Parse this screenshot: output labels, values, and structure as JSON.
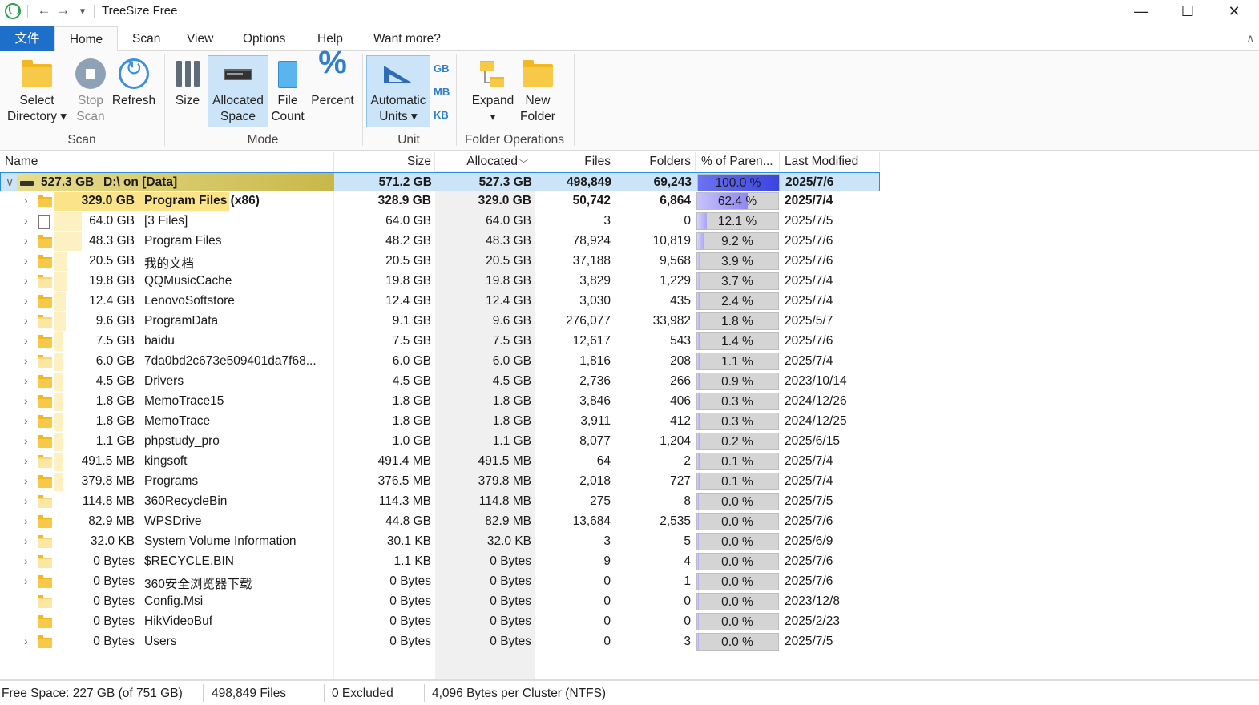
{
  "window": {
    "title": "TreeSize Free",
    "back_glyph": "←",
    "forward_glyph": "→",
    "dropdown_glyph": "▾",
    "minimize_glyph": "—",
    "maximize_glyph": "☐",
    "close_glyph": "✕"
  },
  "ribbon_tabs": {
    "file": "文件",
    "home": "Home",
    "scan": "Scan",
    "view": "View",
    "options": "Options",
    "help": "Help",
    "want_more": "Want more?",
    "collapse_glyph": "∧"
  },
  "ribbon": {
    "select_directory": {
      "line1": "Select",
      "line2": "Directory ▾"
    },
    "stop_scan": {
      "line1": "Stop",
      "line2": "Scan"
    },
    "refresh": {
      "line1": "Refresh"
    },
    "size": {
      "line1": "Size"
    },
    "allocated_space": {
      "line1": "Allocated",
      "line2": "Space"
    },
    "file_count": {
      "line1": "File",
      "line2": "Count"
    },
    "percent": {
      "line1": "Percent",
      "glyph": "%"
    },
    "automatic_units": {
      "line1": "Automatic",
      "line2": "Units ▾"
    },
    "unit_gb": "GB",
    "unit_mb": "MB",
    "unit_kb": "KB",
    "expand": {
      "line1": "Expand",
      "line2": "▾"
    },
    "new_folder": {
      "line1": "New",
      "line2": "Folder"
    },
    "groups": {
      "scan": "Scan",
      "mode": "Mode",
      "unit": "Unit",
      "folder_ops": "Folder Operations"
    }
  },
  "columns": {
    "name": "Name",
    "size": "Size",
    "allocated": "Allocated",
    "sort_glyph": "﹀",
    "files": "Files",
    "folders": "Folders",
    "percent_parent": "% of Paren...",
    "last_modified": "Last Modified"
  },
  "rows": [
    {
      "bar_size": "527.3 GB",
      "name": "D:\\  on  [Data]",
      "size": "571.2 GB",
      "allocated": "527.3 GB",
      "files": "498,849",
      "folders": "69,243",
      "pct": "100.0 %",
      "pct_value": 100.0,
      "modified": "2025/7/6",
      "chevron": "∨",
      "kind": "drive"
    },
    {
      "bar_size": "329.0 GB",
      "name": "Program Files (x86)",
      "size": "328.9 GB",
      "allocated": "329.0 GB",
      "files": "50,742",
      "folders": "6,864",
      "pct": "62.4 %",
      "pct_value": 62.4,
      "modified": "2025/7/4",
      "chevron": "›",
      "kind": "folder"
    },
    {
      "bar_size": "64.0 GB",
      "name": "[3 Files]",
      "size": "64.0 GB",
      "allocated": "64.0 GB",
      "files": "3",
      "folders": "0",
      "pct": "12.1 %",
      "pct_value": 12.1,
      "modified": "2025/7/5",
      "chevron": "›",
      "kind": "file"
    },
    {
      "bar_size": "48.3 GB",
      "name": "Program Files",
      "size": "48.2 GB",
      "allocated": "48.3 GB",
      "files": "78,924",
      "folders": "10,819",
      "pct": "9.2 %",
      "pct_value": 9.2,
      "modified": "2025/7/6",
      "chevron": "›",
      "kind": "folder"
    },
    {
      "bar_size": "20.5 GB",
      "name": "我的文档",
      "size": "20.5 GB",
      "allocated": "20.5 GB",
      "files": "37,188",
      "folders": "9,568",
      "pct": "3.9 %",
      "pct_value": 3.9,
      "modified": "2025/7/6",
      "chevron": "›",
      "kind": "folder"
    },
    {
      "bar_size": "19.8 GB",
      "name": "QQMusicCache",
      "size": "19.8 GB",
      "allocated": "19.8 GB",
      "files": "3,829",
      "folders": "1,229",
      "pct": "3.7 %",
      "pct_value": 3.7,
      "modified": "2025/7/4",
      "chevron": "›",
      "kind": "folder-light"
    },
    {
      "bar_size": "12.4 GB",
      "name": "LenovoSoftstore",
      "size": "12.4 GB",
      "allocated": "12.4 GB",
      "files": "3,030",
      "folders": "435",
      "pct": "2.4 %",
      "pct_value": 2.4,
      "modified": "2025/7/4",
      "chevron": "›",
      "kind": "folder"
    },
    {
      "bar_size": "9.6 GB",
      "name": "ProgramData",
      "size": "9.1 GB",
      "allocated": "9.6 GB",
      "files": "276,077",
      "folders": "33,982",
      "pct": "1.8 %",
      "pct_value": 1.8,
      "modified": "2025/5/7",
      "chevron": "›",
      "kind": "folder-light"
    },
    {
      "bar_size": "7.5 GB",
      "name": "baidu",
      "size": "7.5 GB",
      "allocated": "7.5 GB",
      "files": "12,617",
      "folders": "543",
      "pct": "1.4 %",
      "pct_value": 1.4,
      "modified": "2025/7/6",
      "chevron": "›",
      "kind": "folder"
    },
    {
      "bar_size": "6.0 GB",
      "name": "7da0bd2c673e509401da7f68...",
      "size": "6.0 GB",
      "allocated": "6.0 GB",
      "files": "1,816",
      "folders": "208",
      "pct": "1.1 %",
      "pct_value": 1.1,
      "modified": "2025/7/4",
      "chevron": "›",
      "kind": "folder-light"
    },
    {
      "bar_size": "4.5 GB",
      "name": "Drivers",
      "size": "4.5 GB",
      "allocated": "4.5 GB",
      "files": "2,736",
      "folders": "266",
      "pct": "0.9 %",
      "pct_value": 0.9,
      "modified": "2023/10/14",
      "chevron": "›",
      "kind": "folder"
    },
    {
      "bar_size": "1.8 GB",
      "name": "MemoTrace15",
      "size": "1.8 GB",
      "allocated": "1.8 GB",
      "files": "3,846",
      "folders": "406",
      "pct": "0.3 %",
      "pct_value": 0.3,
      "modified": "2024/12/26",
      "chevron": "›",
      "kind": "folder"
    },
    {
      "bar_size": "1.8 GB",
      "name": "MemoTrace",
      "size": "1.8 GB",
      "allocated": "1.8 GB",
      "files": "3,911",
      "folders": "412",
      "pct": "0.3 %",
      "pct_value": 0.3,
      "modified": "2024/12/25",
      "chevron": "›",
      "kind": "folder"
    },
    {
      "bar_size": "1.1 GB",
      "name": "phpstudy_pro",
      "size": "1.0 GB",
      "allocated": "1.1 GB",
      "files": "8,077",
      "folders": "1,204",
      "pct": "0.2 %",
      "pct_value": 0.2,
      "modified": "2025/6/15",
      "chevron": "›",
      "kind": "folder"
    },
    {
      "bar_size": "491.5 MB",
      "name": "kingsoft",
      "size": "491.4 MB",
      "allocated": "491.5 MB",
      "files": "64",
      "folders": "2",
      "pct": "0.1 %",
      "pct_value": 0.1,
      "modified": "2025/7/4",
      "chevron": "›",
      "kind": "folder-light"
    },
    {
      "bar_size": "379.8 MB",
      "name": "Programs",
      "size": "376.5 MB",
      "allocated": "379.8 MB",
      "files": "2,018",
      "folders": "727",
      "pct": "0.1 %",
      "pct_value": 0.1,
      "modified": "2025/7/4",
      "chevron": "›",
      "kind": "folder"
    },
    {
      "bar_size": "114.8 MB",
      "name": "360RecycleBin",
      "size": "114.3 MB",
      "allocated": "114.8 MB",
      "files": "275",
      "folders": "8",
      "pct": "0.0 %",
      "pct_value": 0.0,
      "modified": "2025/7/5",
      "chevron": "›",
      "kind": "folder-light"
    },
    {
      "bar_size": "82.9 MB",
      "name": "WPSDrive",
      "size": "44.8 GB",
      "allocated": "82.9 MB",
      "files": "13,684",
      "folders": "2,535",
      "pct": "0.0 %",
      "pct_value": 0.0,
      "modified": "2025/7/6",
      "chevron": "›",
      "kind": "folder"
    },
    {
      "bar_size": "32.0 KB",
      "name": "System Volume Information",
      "size": "30.1 KB",
      "allocated": "32.0 KB",
      "files": "3",
      "folders": "5",
      "pct": "0.0 %",
      "pct_value": 0.0,
      "modified": "2025/6/9",
      "chevron": "›",
      "kind": "folder-light"
    },
    {
      "bar_size": "0 Bytes",
      "name": "$RECYCLE.BIN",
      "size": "1.1 KB",
      "allocated": "0 Bytes",
      "files": "9",
      "folders": "4",
      "pct": "0.0 %",
      "pct_value": 0.0,
      "modified": "2025/7/6",
      "chevron": "›",
      "kind": "folder-light"
    },
    {
      "bar_size": "0 Bytes",
      "name": "360安全浏览器下载",
      "size": "0 Bytes",
      "allocated": "0 Bytes",
      "files": "0",
      "folders": "1",
      "pct": "0.0 %",
      "pct_value": 0.0,
      "modified": "2025/7/6",
      "chevron": "›",
      "kind": "folder"
    },
    {
      "bar_size": "0 Bytes",
      "name": "Config.Msi",
      "size": "0 Bytes",
      "allocated": "0 Bytes",
      "files": "0",
      "folders": "0",
      "pct": "0.0 %",
      "pct_value": 0.0,
      "modified": "2023/12/8",
      "chevron": "",
      "kind": "folder-light"
    },
    {
      "bar_size": "0 Bytes",
      "name": "HikVideoBuf",
      "size": "0 Bytes",
      "allocated": "0 Bytes",
      "files": "0",
      "folders": "0",
      "pct": "0.0 %",
      "pct_value": 0.0,
      "modified": "2025/2/23",
      "chevron": "",
      "kind": "folder"
    },
    {
      "bar_size": "0 Bytes",
      "name": "Users",
      "size": "0 Bytes",
      "allocated": "0 Bytes",
      "files": "0",
      "folders": "3",
      "pct": "0.0 %",
      "pct_value": 0.0,
      "modified": "2025/7/5",
      "chevron": "›",
      "kind": "folder"
    }
  ],
  "status": {
    "free_space": "Free Space: 227 GB  (of 751 GB)",
    "files": "498,849 Files",
    "excluded": "0 Excluded",
    "cluster": "4,096 Bytes per Cluster (NTFS)"
  },
  "colors": {
    "accent": "#1e6fc9",
    "root_selection": "#cce4f7",
    "percent_bar": "#a9a4f5",
    "root_bar": "#c8b84a",
    "folder": "#f7c948"
  }
}
